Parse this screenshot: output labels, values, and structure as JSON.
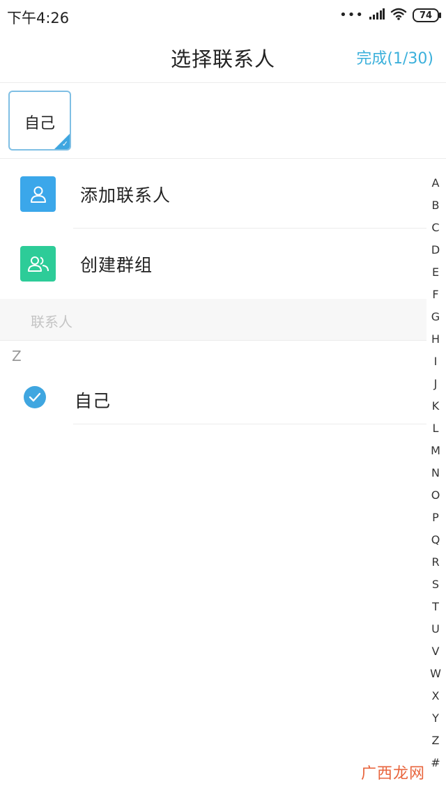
{
  "status_bar": {
    "time": "下午4:26",
    "dots": "•••",
    "battery": "74",
    "icons": [
      "signal-icon",
      "wifi-icon",
      "battery-icon"
    ]
  },
  "header": {
    "title": "选择联系人",
    "done_label": "完成(1/30)"
  },
  "selected": {
    "chips": [
      {
        "label": "自己",
        "checked": true
      }
    ]
  },
  "actions": [
    {
      "label": "添加联系人",
      "icon": "person-icon",
      "color": "#3ba7ea"
    },
    {
      "label": "创建群组",
      "icon": "group-icon",
      "color": "#2dcc98"
    }
  ],
  "section": {
    "label": "联系人"
  },
  "letter_header": "Z",
  "contacts": [
    {
      "name": "自己",
      "checked": true
    }
  ],
  "index_bar": [
    "A",
    "B",
    "C",
    "D",
    "E",
    "F",
    "G",
    "H",
    "I",
    "J",
    "K",
    "L",
    "M",
    "N",
    "O",
    "P",
    "Q",
    "R",
    "S",
    "T",
    "U",
    "V",
    "W",
    "X",
    "Y",
    "Z",
    "#"
  ],
  "watermark": "广西龙网",
  "colors": {
    "accent": "#3fa6e0",
    "done": "#3bb0db",
    "add_contact_icon_bg": "#3ba7ea",
    "create_group_icon_bg": "#2dcc98"
  }
}
